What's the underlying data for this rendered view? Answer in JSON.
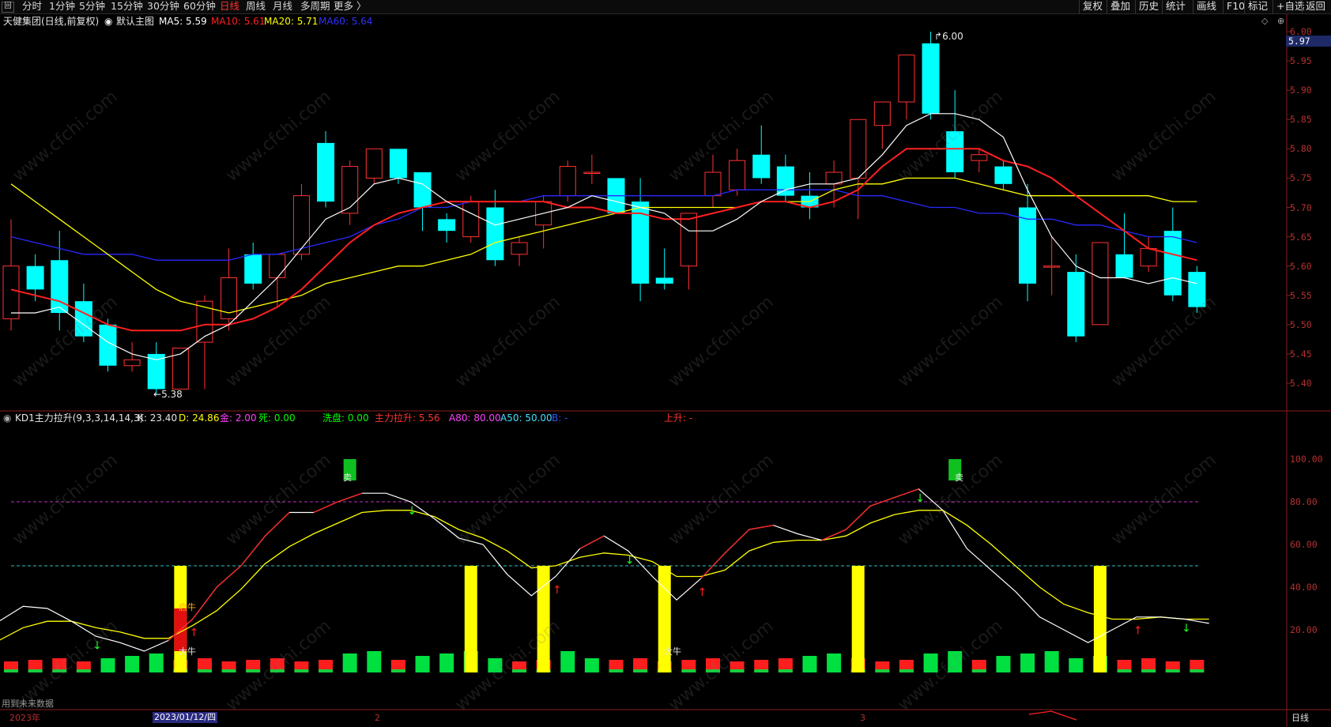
{
  "toolbar": {
    "icon_label": "回",
    "periods": [
      "分时",
      "1分钟",
      "5分钟",
      "15分钟",
      "30分钟",
      "60分钟",
      "日线",
      "周线",
      "月线",
      "多周期",
      "更多 〉"
    ],
    "active_period": "日线",
    "right_buttons": [
      "复权",
      "叠加",
      "历史",
      "统计",
      "画线",
      "F10",
      "标记",
      "+自选",
      "返回"
    ]
  },
  "main_panel": {
    "stock_name": "天健集团(日线,前复权)",
    "chart_label": "默认主图",
    "ma5": "MA5: 5.59",
    "ma10": "MA10: 5.61",
    "ma20": "MA20: 5.71",
    "ma60": "MA60: 5.64",
    "high_marker": "6.00",
    "low_marker": "5.38",
    "current_price": "5.97",
    "y_ticks": [
      "6.00",
      "5.95",
      "5.90",
      "5.85",
      "5.80",
      "5.75",
      "5.70",
      "5.65",
      "5.60",
      "5.55",
      "5.50",
      "5.45",
      "5.40"
    ]
  },
  "indicator_panel": {
    "name": "KD1主力拉升(9,3,3,14,14,3)",
    "k": "K: 23.40",
    "d": "D: 24.86",
    "gold": "金: 2.00",
    "dead": "死: 0.00",
    "wash": "洗盘: 0.00",
    "main_rise": "主力拉升: 5.56",
    "a80": "A80: 80.00",
    "a50": "A50: 50.00",
    "b_label": "B:",
    "b_value": "-",
    "rise_label": "上升:",
    "rise_value": "-",
    "y_ticks": [
      "100.00",
      "80.00",
      "60.00",
      "40.00",
      "20.00"
    ],
    "annotations": {
      "sell": "卖",
      "bull": "大牛",
      "start_bull": "启牛"
    }
  },
  "footer": {
    "future_data": "用到未来数据",
    "year_label": "2023年",
    "date_cursor": "2023/01/12/四",
    "month_2": "2",
    "month_3": "3",
    "period_button": "日线"
  },
  "colors": {
    "up": "#ff3232",
    "down": "#00ffff",
    "ma5": "#ffffff",
    "ma10": "#ff2020",
    "ma20": "#ffff00",
    "ma60": "#2828ff"
  },
  "chart_data": {
    "type": "candlestick",
    "price_axis": {
      "min": 5.4,
      "max": 6.0
    },
    "candles": [
      {
        "o": 5.51,
        "h": 5.68,
        "l": 5.49,
        "c": 5.6
      },
      {
        "o": 5.6,
        "h": 5.62,
        "l": 5.54,
        "c": 5.56
      },
      {
        "o": 5.61,
        "h": 5.66,
        "l": 5.49,
        "c": 5.52
      },
      {
        "o": 5.54,
        "h": 5.57,
        "l": 5.47,
        "c": 5.48
      },
      {
        "o": 5.5,
        "h": 5.51,
        "l": 5.42,
        "c": 5.43
      },
      {
        "o": 5.43,
        "h": 5.47,
        "l": 5.42,
        "c": 5.44
      },
      {
        "o": 5.45,
        "h": 5.47,
        "l": 5.38,
        "c": 5.39
      },
      {
        "o": 5.39,
        "h": 5.46,
        "l": 5.39,
        "c": 5.46
      },
      {
        "o": 5.47,
        "h": 5.55,
        "l": 5.39,
        "c": 5.54
      },
      {
        "o": 5.51,
        "h": 5.63,
        "l": 5.49,
        "c": 5.58
      },
      {
        "o": 5.62,
        "h": 5.64,
        "l": 5.56,
        "c": 5.57
      },
      {
        "o": 5.58,
        "h": 5.62,
        "l": 5.53,
        "c": 5.62
      },
      {
        "o": 5.62,
        "h": 5.74,
        "l": 5.61,
        "c": 5.72
      },
      {
        "o": 5.81,
        "h": 5.83,
        "l": 5.7,
        "c": 5.71
      },
      {
        "o": 5.69,
        "h": 5.78,
        "l": 5.67,
        "c": 5.77
      },
      {
        "o": 5.75,
        "h": 5.8,
        "l": 5.74,
        "c": 5.8
      },
      {
        "o": 5.8,
        "h": 5.8,
        "l": 5.74,
        "c": 5.75
      },
      {
        "o": 5.76,
        "h": 5.76,
        "l": 5.66,
        "c": 5.7
      },
      {
        "o": 5.68,
        "h": 5.69,
        "l": 5.64,
        "c": 5.66
      },
      {
        "o": 5.65,
        "h": 5.72,
        "l": 5.64,
        "c": 5.71
      },
      {
        "o": 5.7,
        "h": 5.73,
        "l": 5.6,
        "c": 5.61
      },
      {
        "o": 5.62,
        "h": 5.65,
        "l": 5.6,
        "c": 5.64
      },
      {
        "o": 5.67,
        "h": 5.72,
        "l": 5.63,
        "c": 5.71
      },
      {
        "o": 5.72,
        "h": 5.78,
        "l": 5.71,
        "c": 5.77
      },
      {
        "o": 5.76,
        "h": 5.79,
        "l": 5.74,
        "c": 5.76
      },
      {
        "o": 5.75,
        "h": 5.75,
        "l": 5.7,
        "c": 5.69
      },
      {
        "o": 5.71,
        "h": 5.75,
        "l": 5.54,
        "c": 5.57
      },
      {
        "o": 5.58,
        "h": 5.63,
        "l": 5.56,
        "c": 5.57
      },
      {
        "o": 5.6,
        "h": 5.69,
        "l": 5.56,
        "c": 5.69
      },
      {
        "o": 5.72,
        "h": 5.79,
        "l": 5.7,
        "c": 5.76
      },
      {
        "o": 5.73,
        "h": 5.8,
        "l": 5.72,
        "c": 5.78
      },
      {
        "o": 5.79,
        "h": 5.84,
        "l": 5.74,
        "c": 5.75
      },
      {
        "o": 5.77,
        "h": 5.79,
        "l": 5.71,
        "c": 5.72
      },
      {
        "o": 5.72,
        "h": 5.76,
        "l": 5.68,
        "c": 5.7
      },
      {
        "o": 5.74,
        "h": 5.78,
        "l": 5.7,
        "c": 5.76
      },
      {
        "o": 5.75,
        "h": 5.8,
        "l": 5.68,
        "c": 5.85
      },
      {
        "o": 5.84,
        "h": 5.88,
        "l": 5.8,
        "c": 5.88
      },
      {
        "o": 5.88,
        "h": 5.96,
        "l": 5.85,
        "c": 5.96
      },
      {
        "o": 5.98,
        "h": 6.0,
        "l": 5.85,
        "c": 5.86
      },
      {
        "o": 5.83,
        "h": 5.9,
        "l": 5.75,
        "c": 5.76
      },
      {
        "o": 5.78,
        "h": 5.8,
        "l": 5.76,
        "c": 5.79
      },
      {
        "o": 5.77,
        "h": 5.78,
        "l": 5.73,
        "c": 5.74
      },
      {
        "o": 5.7,
        "h": 5.74,
        "l": 5.54,
        "c": 5.57
      },
      {
        "o": 5.6,
        "h": 5.65,
        "l": 5.55,
        "c": 5.6
      },
      {
        "o": 5.59,
        "h": 5.62,
        "l": 5.47,
        "c": 5.48
      },
      {
        "o": 5.5,
        "h": 5.64,
        "l": 5.5,
        "c": 5.64
      },
      {
        "o": 5.62,
        "h": 5.69,
        "l": 5.58,
        "c": 5.58
      },
      {
        "o": 5.6,
        "h": 5.65,
        "l": 5.59,
        "c": 5.63
      },
      {
        "o": 5.66,
        "h": 5.7,
        "l": 5.54,
        "c": 5.55
      },
      {
        "o": 5.59,
        "h": 5.6,
        "l": 5.52,
        "c": 5.53
      }
    ],
    "ma5": [
      5.52,
      5.52,
      5.53,
      5.5,
      5.47,
      5.45,
      5.44,
      5.45,
      5.48,
      5.5,
      5.54,
      5.58,
      5.63,
      5.68,
      5.7,
      5.74,
      5.75,
      5.74,
      5.71,
      5.69,
      5.67,
      5.68,
      5.69,
      5.7,
      5.72,
      5.71,
      5.7,
      5.69,
      5.66,
      5.66,
      5.68,
      5.71,
      5.73,
      5.74,
      5.74,
      5.75,
      5.79,
      5.84,
      5.86,
      5.86,
      5.85,
      5.82,
      5.73,
      5.65,
      5.6,
      5.58,
      5.58,
      5.57,
      5.58,
      5.57
    ],
    "ma10": [
      5.56,
      5.55,
      5.54,
      5.52,
      5.5,
      5.49,
      5.49,
      5.49,
      5.5,
      5.5,
      5.51,
      5.53,
      5.56,
      5.6,
      5.64,
      5.67,
      5.69,
      5.7,
      5.71,
      5.71,
      5.71,
      5.71,
      5.71,
      5.7,
      5.7,
      5.69,
      5.69,
      5.68,
      5.68,
      5.69,
      5.7,
      5.71,
      5.71,
      5.7,
      5.71,
      5.73,
      5.77,
      5.8,
      5.8,
      5.8,
      5.8,
      5.78,
      5.77,
      5.75,
      5.72,
      5.69,
      5.66,
      5.63,
      5.62,
      5.61
    ],
    "ma20": [
      5.74,
      5.71,
      5.68,
      5.65,
      5.62,
      5.59,
      5.56,
      5.54,
      5.53,
      5.52,
      5.53,
      5.54,
      5.55,
      5.57,
      5.58,
      5.59,
      5.6,
      5.6,
      5.61,
      5.62,
      5.64,
      5.65,
      5.66,
      5.67,
      5.68,
      5.69,
      5.7,
      5.7,
      5.7,
      5.7,
      5.7,
      5.71,
      5.71,
      5.71,
      5.73,
      5.74,
      5.74,
      5.75,
      5.75,
      5.75,
      5.74,
      5.73,
      5.72,
      5.72,
      5.72,
      5.72,
      5.72,
      5.72,
      5.71,
      5.71
    ],
    "ma60": [
      5.65,
      5.64,
      5.63,
      5.62,
      5.62,
      5.62,
      5.61,
      5.61,
      5.61,
      5.61,
      5.62,
      5.62,
      5.63,
      5.64,
      5.65,
      5.67,
      5.68,
      5.7,
      5.7,
      5.71,
      5.71,
      5.71,
      5.72,
      5.72,
      5.72,
      5.72,
      5.72,
      5.72,
      5.72,
      5.72,
      5.73,
      5.73,
      5.73,
      5.73,
      5.73,
      5.72,
      5.72,
      5.71,
      5.7,
      5.7,
      5.69,
      5.69,
      5.68,
      5.68,
      5.67,
      5.67,
      5.66,
      5.65,
      5.65,
      5.64
    ],
    "kd_axis": {
      "min": 0,
      "max": 100
    },
    "k_line": [
      24,
      31,
      30,
      24,
      17,
      14,
      10,
      15,
      25,
      40,
      50,
      64,
      75,
      75,
      80,
      84,
      84,
      80,
      72,
      63,
      60,
      46,
      36,
      45,
      58,
      64,
      57,
      45,
      34,
      44,
      56,
      67,
      69,
      65,
      62,
      67,
      78,
      82,
      86,
      76,
      58,
      48,
      38,
      26,
      20,
      14,
      20,
      26,
      26,
      25,
      23
    ],
    "d_line": [
      15,
      21,
      24,
      24,
      21,
      19,
      16,
      16,
      22,
      29,
      39,
      51,
      59,
      65,
      70,
      75,
      76,
      76,
      73,
      67,
      63,
      57,
      49,
      50,
      54,
      56,
      55,
      52,
      45,
      45,
      48,
      57,
      61,
      62,
      62,
      64,
      70,
      74,
      76,
      76,
      69,
      60,
      50,
      40,
      32,
      28,
      25,
      25,
      26,
      25,
      25
    ],
    "threshold_80": 80,
    "threshold_50": 50,
    "yellow_bars": [
      7,
      19,
      22,
      27,
      35,
      45
    ],
    "sell_marks": [
      14,
      39
    ],
    "volume_type": [
      1,
      1,
      1,
      1,
      0,
      0,
      0,
      1,
      1,
      1,
      1,
      1,
      1,
      1,
      0,
      0,
      1,
      0,
      0,
      0,
      0,
      1,
      1,
      0,
      0,
      1,
      1,
      1,
      1,
      1,
      1,
      1,
      1,
      0,
      0,
      1,
      1,
      1,
      0,
      0,
      1,
      0,
      0,
      0,
      0,
      0,
      1,
      1,
      1,
      1
    ]
  }
}
